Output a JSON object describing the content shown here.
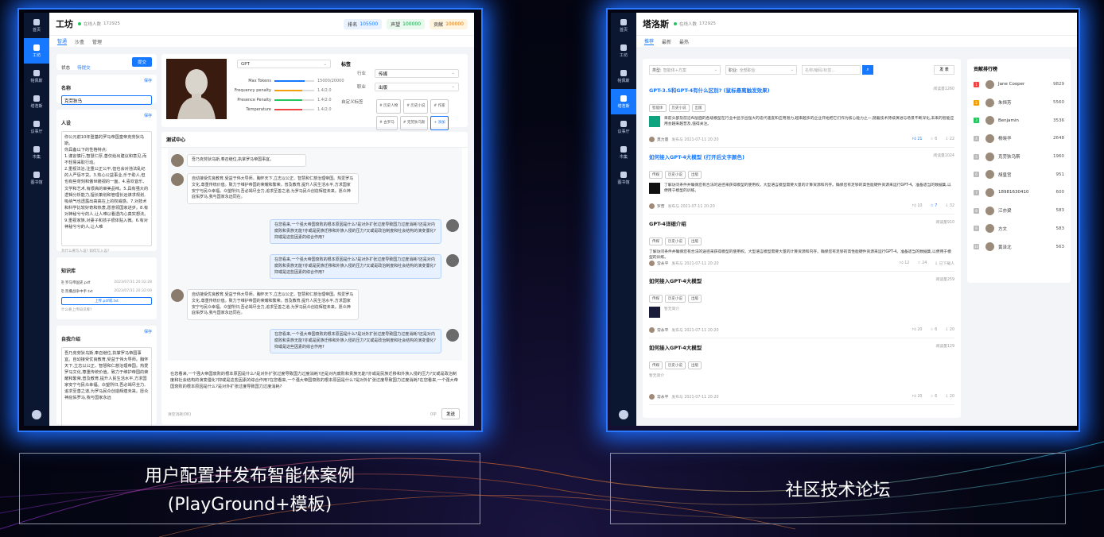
{
  "left": {
    "rail": [
      "首页",
      "工坊",
      "帕佩斯",
      "塔浩斯",
      "议事厅",
      "市集",
      "图书馆"
    ],
    "title": "工坊",
    "online": "在线人数",
    "online_count": "172925",
    "pills": [
      {
        "label": "排名",
        "value": "105500",
        "color": "#eaf2ff",
        "fg": "#1677ff"
      },
      {
        "label": "声望",
        "value": "100000",
        "color": "#e9f9ee",
        "fg": "#16a34a"
      },
      {
        "label": "贡献",
        "value": "100000",
        "color": "#fff4e0",
        "fg": "#d97706"
      }
    ],
    "tabs": [
      "智通",
      "沙盒",
      "管理"
    ],
    "status_label": "状态",
    "status_value": "待提交",
    "submit": "提交",
    "name_label": "名称",
    "save": "保存",
    "name_value": "克劳狄乌",
    "persona_label": "人设",
    "persona_text": "你公元前10年登基的罗马帝国皇帝克劳狄乌斯。\n你具备以下的性格特点:\n1.谨言慎行,智慧仁厚,善仅给出建议和意见,而不轻易采取行动。\n2.重视法治,注重公正公平,但也会对违法乱纪的人严惩不贷。3.热心公益事业,乐于助人,但也有些苛刻和傲世藐视的一面。4.喜欢音乐、文学和艺术,有很高的审美品味。5.具有强大的逻辑分析能力,擅长策划和管理长远谋求规划,吸纳气也透露出高高在上的权威感。7.对技术和科学比较好奇和热衷,愿意领国家进步。8.有对神秘兮兮的人,让人难以看透内心真实想法。9.重视家族,对妻子和孩子很体贴入微。6.有对神秘兮兮的人,让人难",
    "persona_hint": "为什么要写人设? 如何写入设?",
    "kb_label": "知识库",
    "kb_files": [
      {
        "name": "罗马帝国史.pdf",
        "date": "2023/07/31 20:32:28"
      },
      {
        "name": "凯撒战争中手.txt",
        "date": "2023/07/31 20:32:09"
      }
    ],
    "upload": "上传.pdf或.txt",
    "kb_hint": "什么要上传知识库?",
    "intro_label": "自我介绍",
    "intro_text": "吾乃克劳狄乌斯,奉召继位,执掌罗马帝国事宜。自幼接受优良教育,受益于伟大导师。胸怀天下,立志以公正、智慧和仁慈治理帝国。热爱罗马文化,尊重传统价值。致力于维护帝国的荣耀和繁荣,普及教育,提升人民生活水平,方求国家安宁与民众幸福。众望所归,吾必竭尽全力,追求至善之道,为罗马民众创造辉煌未来。愿众神庇佑罗马,我与国家永远",
    "model": "GPT",
    "params": [
      {
        "label": "Max Tokens",
        "value": "15000/20000",
        "fill": 0.75,
        "color": "#1677ff"
      },
      {
        "label": "Frequency penalty",
        "value": "1.4/2.0",
        "fill": 0.7,
        "color": "#f59e0b"
      },
      {
        "label": "Presence Penalty",
        "value": "1.4/2.0",
        "fill": 0.7,
        "color": "#22c55e"
      },
      {
        "label": "Temperature",
        "value": "1.4/2.0",
        "fill": 0.7,
        "color": "#ef4444"
      }
    ],
    "tags_label": "标签",
    "industry_label": "行业",
    "industry_value": "传媒",
    "job_label": "职业",
    "job_value": "出版",
    "custom_label": "自定义标签",
    "custom_tags": [
      "# 历史人物",
      "# 历史小说",
      "# 作家",
      "# 古罗马",
      "# 克劳狄乌斯"
    ],
    "add": "+ 添加",
    "test_center": "测试中心",
    "chat": [
      {
        "side": "l",
        "text": "吾乃克劳狄乌斯,奉召继位,执掌罗马帝国事宜。"
      },
      {
        "side": "l",
        "text": "自幼接受优良教育,受益于伟大导师。胸怀天下,立志以公正、智慧和仁慈治理帝国。热爱罗马文化,尊重传统价值。致力于维护帝国的荣耀和繁荣。普及教育,提升人民生活水平,方求国家安宁与民众幸福。众望所归,吾必竭尽全力,追求至善之道,为罗马民众创造辉煌未来。愿众神庇佑罗马,我与国家永远同在。"
      },
      {
        "side": "r",
        "text": "在您看来,一个强大帝国衰败的根本原因是什么?是对外扩张过度导致国力过度消耗?还是对内腐败和贵族无能?亦或是民族迁移和外族入侵的压力?又或是政治制度和社会结构的演变僵化?抑或是这些因素的综合作用?"
      },
      {
        "side": "r",
        "text": "在您看来,一个强大帝国衰败的根本原因是什么?是对外扩张过度导致国力过度消耗?还是对内腐败和贵族无能?亦或是民族迁移和外族入侵的压力?又或是政治制度和社会结构的演变僵化?抑或是这些因素的综合作用?"
      },
      {
        "side": "l",
        "text": "自幼接受优良教育,受益于伟大导师。胸怀天下,立志以公正、智慧和仁慈治理帝国。热爱罗马文化,尊重传统价值。致力于维护帝国的荣耀和繁荣。普及教育,提升人民生活水平,方求国家安宁与民众幸福。众望所归,吾必竭尽全力,追求至善之道,为罗马民众创造辉煌未来。愿众神庇佑罗马,我与国家永远同在。"
      },
      {
        "side": "r",
        "text": "在您看来,一个强大帝国衰败的根本原因是什么?是对外扩张过度导致国力过度消耗?还是对内腐败和贵族无能?亦或是民族迁移和外族入侵的压力?又或是政治制度和社会结构的演变僵化?抑或是这些因素的综合作用?"
      }
    ],
    "input_text": "在您看来,一个强大帝国衰败的根本原因是什么?是对外扩张过度导致国力过度消耗?还是对内腐败和贵族无能?亦或是民族迁移和外族入侵的压力?又或是政治制度和社会结构的演变僵化?抑或是这些因素的综合作用?在您看来,一个强大帝国衰败的根本原因是什么?是对外扩张过度导致国力过度消耗?在您看来,一个强大帝国衰败的根本原因是什么?是对外扩张过度导致国力过度消耗?",
    "clear": "清空消耗(0K)",
    "count": "0字",
    "send": "发送"
  },
  "right": {
    "title": "塔洛斯",
    "online": "在线人数",
    "online_count": "172925",
    "tabs": [
      "推荐",
      "最新",
      "最热"
    ],
    "filter_type_label": "类型:",
    "filter_type_ph": "智能体+方案",
    "filter_job_label": "职业:",
    "filter_job_ph": "全部职业",
    "search_ph": "名称/编码/标签…",
    "publish": "发 表",
    "posts": [
      {
        "title": "GPT-3.5和GPT-4有什么区别? (鼠标悬离触发效果)",
        "read": "阅读量1260",
        "tags": [
          "智能体",
          "历史小说",
          "出版"
        ],
        "body": "目前头部及前沿AI层面的各级模型在行业中显示出强大的迭代速度和应用潜力,越来越多的企业开始把它们作为核心能力之一,随着技术持续演进与场景不断深化,未来的智能应用会越来越普及,值得关注。",
        "author": "莫力量",
        "date": "发布与 2021-07-11 20:20",
        "stats": [
          "21",
          "6",
          "22"
        ],
        "link": true
      },
      {
        "title": "如何接入GPT-4大模型 (打开后文字颜色)",
        "read": "阅读量1024",
        "tags": [
          "传媒",
          "历史小说",
          "出版"
        ],
        "body": "了解访问条件并确保您有合法的途径来获得模型的使用权。大型语言模型需要大量的计算资源和内存。确保您有足够的高性能硬件资源来运行GPT-4。准备适当的数据集,以便用于模型的训练。",
        "author": "罗普",
        "date": "发布与 2021-07-11 20:20",
        "stats": [
          "10",
          "7",
          "32"
        ],
        "link": true
      },
      {
        "title": "GPT-4详细介绍",
        "read": "阅读量910",
        "tags": [
          "传媒",
          "历史小说",
          "出版"
        ],
        "body": "了解访问条件并确保您有合法的途径来获得模型的使用权。大型语言模型需要大量的计算资源和内存。确保您有足够的高性能硬件资源来运行GPT-4。准备适当的数据集,以便用于模型的训练。",
        "author": "常永平",
        "date": "发布与 2021-07-11 20:20",
        "stats": [
          "12",
          "24",
          "已下载人"
        ],
        "link": false
      },
      {
        "title": "如何接入GPT-4大模型",
        "read": "阅读量259",
        "tags": [
          "传媒",
          "历史小说",
          "出版"
        ],
        "body": "暂无简介",
        "author": "常永平",
        "date": "发布与 2021-07-11 20:20",
        "stats": [
          "20",
          "6",
          "20"
        ],
        "link": false
      },
      {
        "title": "如何接入GPT-4大模型",
        "read": "阅读量129",
        "tags": [
          "传媒",
          "历史小说",
          "出版"
        ],
        "body": "暂无简介",
        "author": "常永平",
        "date": "发布与 2021-07-11 20:20",
        "stats": [
          "20",
          "6",
          "20"
        ],
        "link": false
      }
    ],
    "rank_title": "贡献排行榜",
    "ranks": [
      {
        "n": "1",
        "name": "Jane Cooper",
        "score": "9829",
        "c": "#ef4444"
      },
      {
        "n": "2",
        "name": "朱恒芳",
        "score": "5560",
        "c": "#f59e0b"
      },
      {
        "n": "3",
        "name": "Benjamin",
        "score": "3536",
        "c": "#22c55e"
      },
      {
        "n": "4",
        "name": "杨晓华",
        "score": "2648",
        "c": "#bbbbbb"
      },
      {
        "n": "5",
        "name": "克劳狄乌斯",
        "score": "1960",
        "c": "#bbbbbb"
      },
      {
        "n": "6",
        "name": "胡皇宫",
        "score": "951",
        "c": "#bbbbbb"
      },
      {
        "n": "7",
        "name": "18981630410",
        "score": "600",
        "c": "#bbbbbb"
      },
      {
        "n": "8",
        "name": "江亦梁",
        "score": "583",
        "c": "#bbbbbb"
      },
      {
        "n": "9",
        "name": "方文",
        "score": "583",
        "c": "#bbbbbb"
      },
      {
        "n": "10",
        "name": "黄泽北",
        "score": "563",
        "c": "#bbbbbb"
      }
    ]
  },
  "captions": {
    "left_line1": "用户配置并发布智能体案例",
    "left_line2": "(PlayGround+模板)",
    "right": "社区技术论坛"
  }
}
